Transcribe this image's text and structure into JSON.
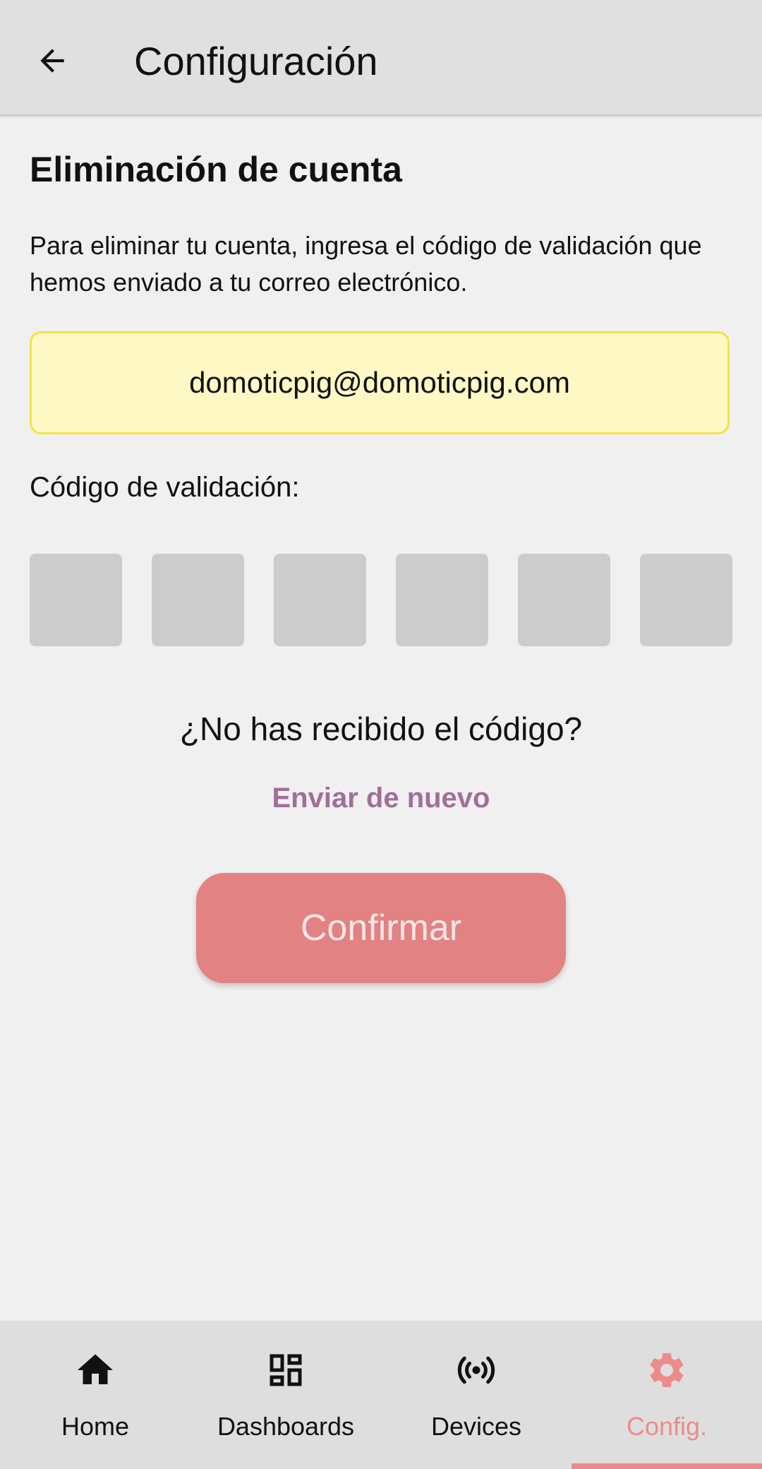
{
  "app_bar": {
    "title": "Configuración",
    "back_icon": "arrow-back-icon"
  },
  "main": {
    "section_title": "Eliminación de cuenta",
    "instructions": "Para eliminar tu cuenta, ingresa el código de validación que hemos enviado a tu correo electrónico.",
    "email": "domoticpig@domoticpig.com",
    "code_label": "Código de validación:",
    "code_cells": [
      "",
      "",
      "",
      "",
      "",
      ""
    ],
    "resend_question": "¿No has recibido el código?",
    "resend_link": "Enviar de nuevo",
    "confirm_label": "Confirmar"
  },
  "bottom_nav": {
    "items": [
      {
        "label": "Home",
        "icon": "home-icon"
      },
      {
        "label": "Dashboards",
        "icon": "dashboard-icon"
      },
      {
        "label": "Devices",
        "icon": "broadcast-icon"
      },
      {
        "label": "Config.",
        "icon": "gear-icon"
      }
    ],
    "active_index": 3
  },
  "colors": {
    "background": "#f0f0f0",
    "app_bar": "#e0e0e0",
    "email_box_bg": "#fdf8c4",
    "email_box_border": "#f3e34a",
    "code_cell": "#cccccc",
    "resend_link": "#a07099",
    "confirm_button": "#e28282",
    "accent": "#ec8b8b",
    "nav_bg": "#dedede"
  }
}
